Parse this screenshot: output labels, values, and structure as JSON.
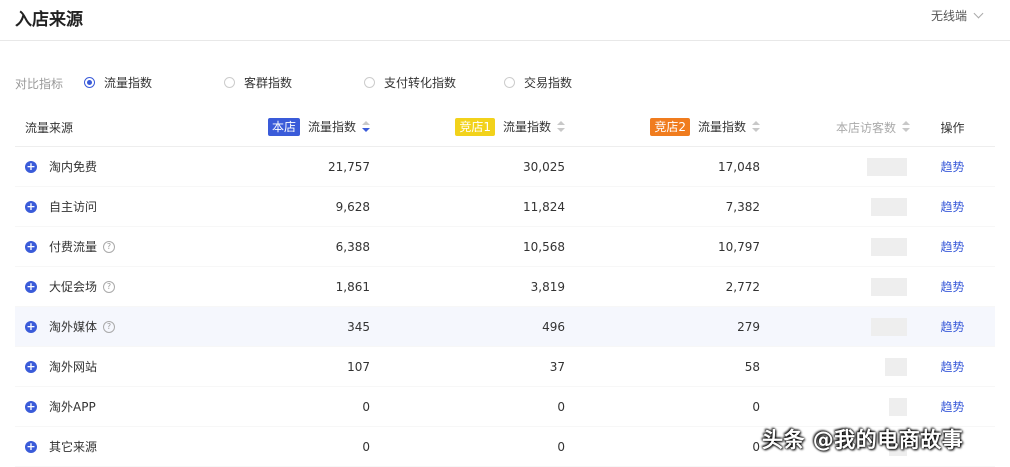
{
  "header": {
    "title": "入店来源",
    "device": "无线端"
  },
  "compare": {
    "label": "对比指标",
    "options": [
      {
        "label": "流量指数",
        "selected": true
      },
      {
        "label": "客群指数",
        "selected": false
      },
      {
        "label": "支付转化指数",
        "selected": false
      },
      {
        "label": "交易指数",
        "selected": false
      }
    ]
  },
  "table": {
    "headers": {
      "source": "流量来源",
      "own_tag": "本店",
      "comp1_tag": "竞店1",
      "comp2_tag": "竞店2",
      "metric": "流量指数",
      "visitors": "本店访客数",
      "action": "操作"
    },
    "tag_colors": {
      "own": "#3a5bd9",
      "comp1": "#f2d21b",
      "comp2": "#f07c1e"
    },
    "rows": [
      {
        "source": "淘内免费",
        "help": false,
        "own": "21,757",
        "comp1": "30,025",
        "comp2": "17,048",
        "action": "趋势"
      },
      {
        "source": "自主访问",
        "help": false,
        "own": "9,628",
        "comp1": "11,824",
        "comp2": "7,382",
        "action": "趋势"
      },
      {
        "source": "付费流量",
        "help": true,
        "own": "6,388",
        "comp1": "10,568",
        "comp2": "10,797",
        "action": "趋势"
      },
      {
        "source": "大促会场",
        "help": true,
        "own": "1,861",
        "comp1": "3,819",
        "comp2": "2,772",
        "action": "趋势"
      },
      {
        "source": "淘外媒体",
        "help": true,
        "own": "345",
        "comp1": "496",
        "comp2": "279",
        "action": "趋势"
      },
      {
        "source": "淘外网站",
        "help": false,
        "own": "107",
        "comp1": "37",
        "comp2": "58",
        "action": "趋势"
      },
      {
        "source": "淘外APP",
        "help": false,
        "own": "0",
        "comp1": "0",
        "comp2": "0",
        "action": "趋势"
      },
      {
        "source": "其它来源",
        "help": false,
        "own": "0",
        "comp1": "0",
        "comp2": "0",
        "action": ""
      }
    ]
  },
  "watermark": "头条 @我的电商故事"
}
